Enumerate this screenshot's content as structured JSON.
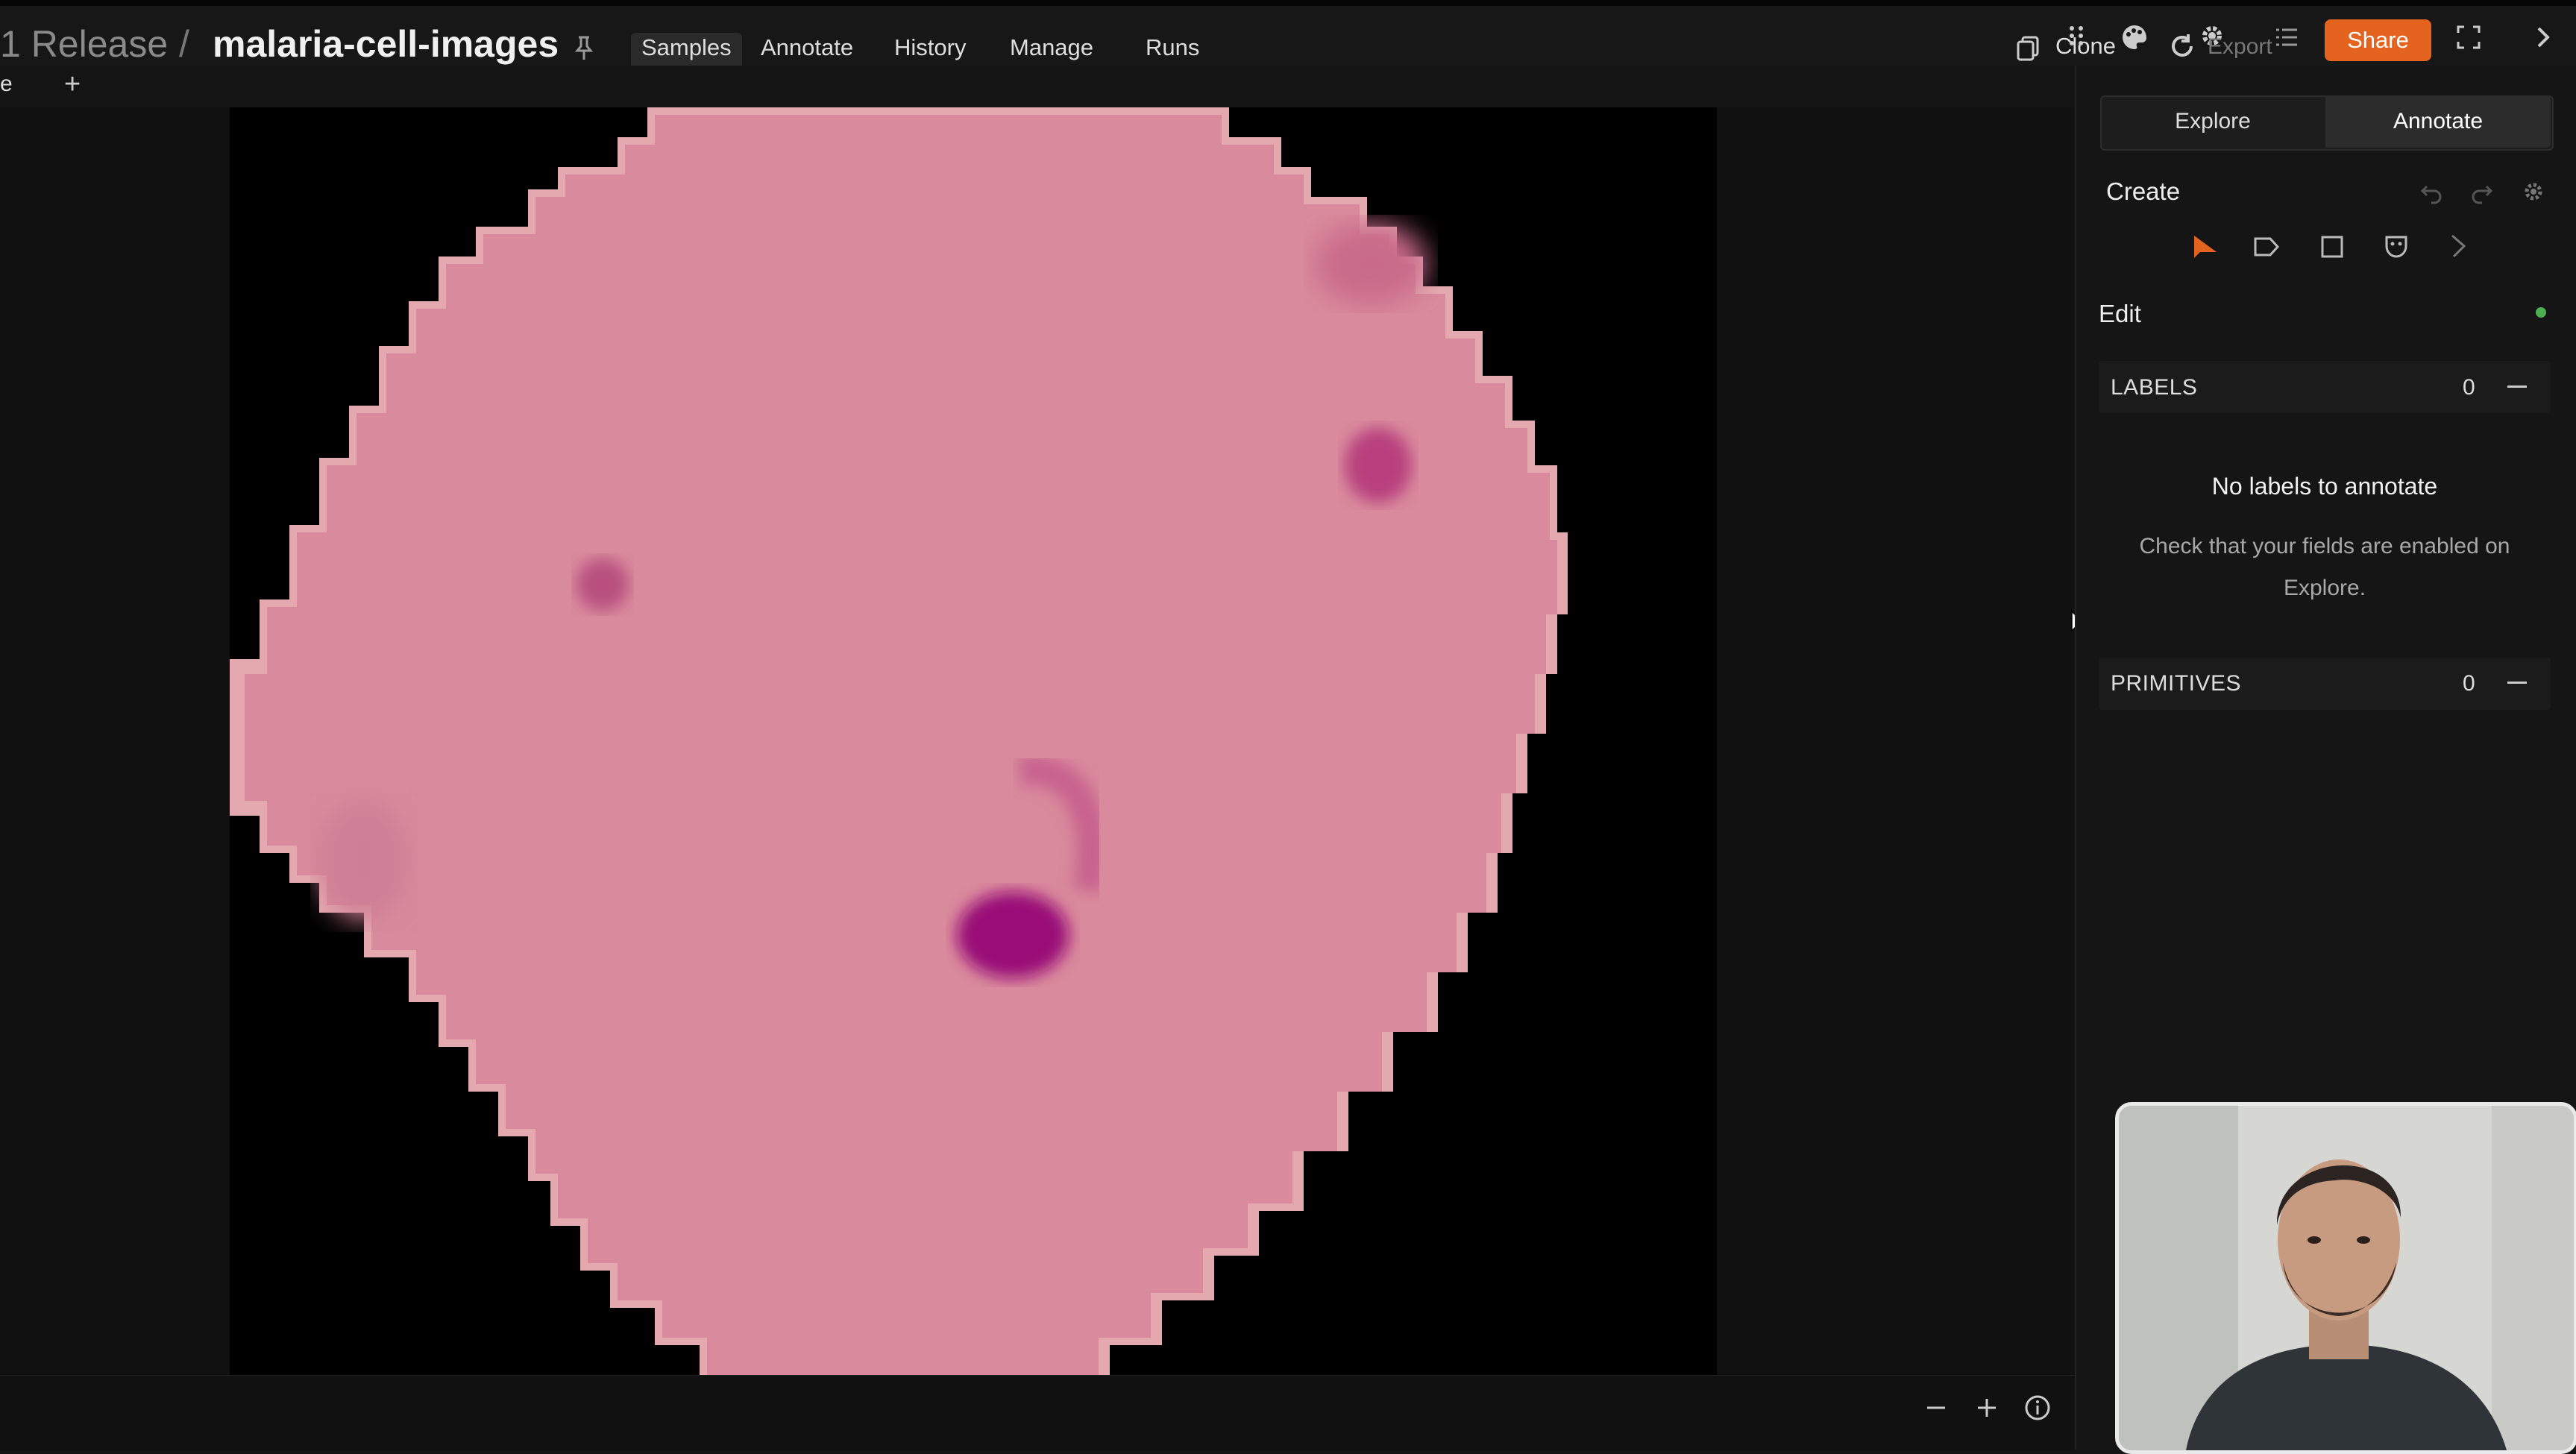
{
  "breadcrumb": {
    "prefix": "1 Release",
    "separator": "/",
    "dataset_name": "malaria-cell-images"
  },
  "nav": {
    "tabs": [
      "Samples",
      "Annotate",
      "History",
      "Manage",
      "Runs"
    ],
    "active": "Samples"
  },
  "toolbar": {
    "clone_label": "Clone",
    "export_label": "Export",
    "share_label": "Share",
    "accent": "#e3631f"
  },
  "subbar": {
    "tab_label": "e",
    "add_label": "+"
  },
  "panel": {
    "modes": {
      "explore": "Explore",
      "annotate": "Annotate",
      "active": "Annotate"
    },
    "create": {
      "title": "Create",
      "tools": [
        "select-arrow-icon",
        "tag-icon",
        "box-icon",
        "mask-icon",
        "polyline-icon"
      ]
    },
    "edit": {
      "title": "Edit",
      "status_color": "#4caf50"
    },
    "labels": {
      "title": "LABELS",
      "count": "0",
      "empty_title": "No labels to annotate",
      "empty_body": "Check that your fields are enabled on Explore."
    },
    "primitives": {
      "title": "PRIMITIVES",
      "count": "0"
    }
  },
  "viewer": {
    "controls": [
      "zoom-out-icon",
      "zoom-in-icon",
      "info-icon"
    ],
    "cell_color": "#d98a9c",
    "parasite_color": "#9a0f78"
  }
}
